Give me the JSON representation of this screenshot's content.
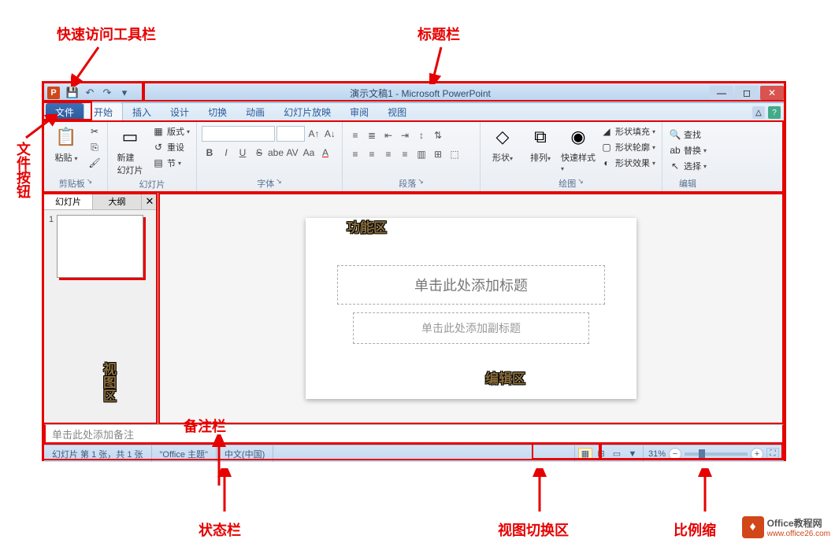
{
  "annotations": {
    "qat": "快速访问工具栏",
    "titlebar": "标题栏",
    "file_btn": "文件按钮",
    "ribbon": "功能区",
    "view_area": "视图区",
    "edit_area": "编辑区",
    "notes": "备注栏",
    "status": "状态栏",
    "view_switch": "视图切换区",
    "zoom": "比例缩",
    "watermark_title": "Office教程网",
    "watermark_url": "www.office26.com"
  },
  "titlebar": {
    "title": "演示文稿1 - Microsoft PowerPoint",
    "app_letter": "P"
  },
  "tabs": {
    "file": "文件",
    "home": "开始",
    "insert": "插入",
    "design": "设计",
    "transitions": "切换",
    "animations": "动画",
    "slideshow": "幻灯片放映",
    "review": "审阅",
    "view": "视图"
  },
  "ribbon": {
    "clipboard": {
      "paste": "粘贴",
      "label": "剪贴板"
    },
    "slides": {
      "new_slide": "新建\n幻灯片",
      "layout": "版式",
      "reset": "重设",
      "section": "节",
      "label": "幻灯片"
    },
    "font": {
      "label": "字体"
    },
    "paragraph": {
      "label": "段落"
    },
    "drawing": {
      "shapes": "形状",
      "arrange": "排列",
      "quick_styles": "快速样式",
      "fill": "形状填充",
      "outline": "形状轮廓",
      "effects": "形状效果",
      "label": "绘图"
    },
    "editing": {
      "find": "查找",
      "replace": "替换",
      "select": "选择",
      "label": "编辑"
    }
  },
  "left_panel": {
    "tab_slides": "幻灯片",
    "tab_outline": "大纲",
    "slide_num": "1"
  },
  "slide": {
    "title_placeholder": "单击此处添加标题",
    "subtitle_placeholder": "单击此处添加副标题"
  },
  "notes": {
    "placeholder": "单击此处添加备注"
  },
  "status": {
    "slide_info": "幻灯片 第 1 张，共 1 张",
    "theme": "\"Office 主题\"",
    "language": "中文(中国)",
    "zoom": "31%"
  }
}
